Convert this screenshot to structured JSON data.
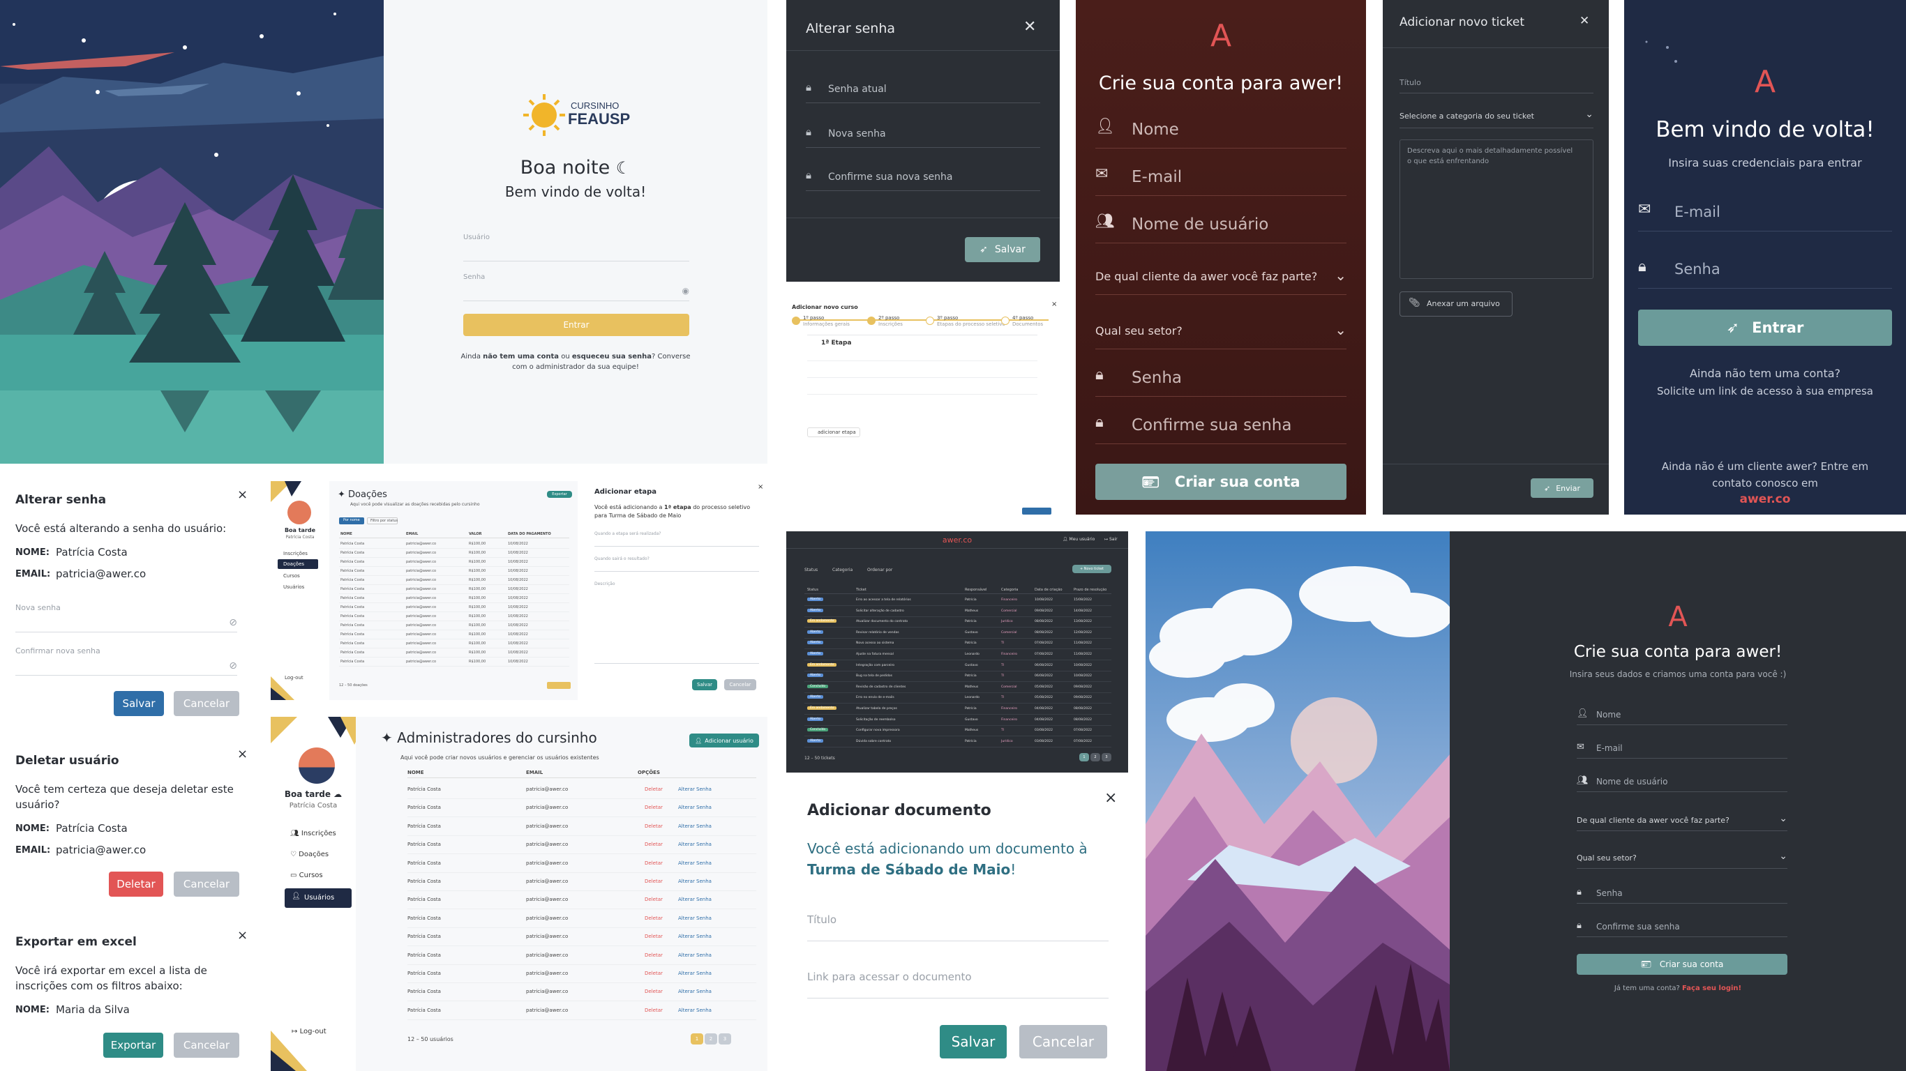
{
  "login_light": {
    "logo_top": "CURSINHO",
    "logo_main": "FEAUSP",
    "greeting": "Boa noite",
    "welcome": "Bem vindo de volta!",
    "user_placeholder": "Usuário",
    "password_placeholder": "Senha",
    "enter_button": "Entrar",
    "footer_1": "Ainda ",
    "footer_bold1": "não tem uma conta",
    "footer_2": " ou ",
    "footer_bold2": "esqueceu sua senha",
    "footer_3": "? Converse",
    "footer_4": "com o administrador da sua equipe!"
  },
  "change_pw_dark": {
    "title": "Alterar senha",
    "current": "Senha atual",
    "new": "Nova senha",
    "confirm": "Confirme sua nova senha",
    "save": "Salvar"
  },
  "wizard": {
    "title": "Adicionar novo curso",
    "steps": [
      {
        "label": "1º passo",
        "sub": "Informações gerais"
      },
      {
        "label": "2º passo",
        "sub": "Inscrições"
      },
      {
        "label": "3º passo",
        "sub": "Etapas do processo seletivo"
      },
      {
        "label": "4º passo",
        "sub": "Documentos"
      }
    ],
    "stage": "1ª Etapa",
    "add_stage": "adicionar etapa"
  },
  "signup_brown": {
    "title": "Crie sua conta para awer!",
    "name": "Nome",
    "email": "E-mail",
    "username": "Nome de usuário",
    "client": "De qual cliente da awer você faz parte?",
    "sector": "Qual seu setor?",
    "password": "Senha",
    "confirm": "Confirme sua senha",
    "button": "Criar sua conta"
  },
  "ticket": {
    "title": "Adicionar novo ticket",
    "field_title": "Título",
    "category": "Selecione a categoria do seu ticket",
    "description": "Descreva aqui o mais detalhadamente possível o que está enfrentando",
    "attach": "Anexar um arquivo",
    "send": "Enviar"
  },
  "login_navy": {
    "title": "Bem vindo de volta!",
    "subtitle": "Insira suas credenciais para entrar",
    "email": "E-mail",
    "password": "Senha",
    "button": "Entrar",
    "no_account_1": "Ainda não tem uma conta?",
    "no_account_2": "Solicite um link de acesso à sua empresa",
    "client_1": "Ainda não é um cliente awer? Entre em",
    "client_2": "contato conosco em",
    "link": "awer.co"
  },
  "dialogs": {
    "alter": {
      "title": "Alterar senha",
      "desc": "Você está alterando a senha do usuário:",
      "name_label": "NOME:",
      "name": "Patrícia Costa",
      "email_label": "EMAIL:",
      "email": "patricia@awer.co",
      "new_pw": "Nova senha",
      "confirm_pw": "Confirmar nova senha",
      "save": "Salvar",
      "cancel": "Cancelar"
    },
    "delete": {
      "title": "Deletar usuário",
      "desc_1": "Você tem certeza que deseja deletar este",
      "desc_2": "usuário?",
      "name_label": "NOME:",
      "name": "Patrícia Costa",
      "email_label": "EMAIL:",
      "email": "patricia@awer.co",
      "delete": "Deletar",
      "cancel": "Cancelar"
    },
    "export": {
      "title": "Exportar em excel",
      "desc_1": "Você irá exportar em excel a lista de",
      "desc_2": "inscrições com os filtros abaixo:",
      "name_label": "NOME:",
      "name": "Maria da Silva",
      "export": "Exportar",
      "cancel": "Cancelar"
    }
  },
  "donations": {
    "greeting": "Boa tarde",
    "user": "Patrícia Costa",
    "title": "Doações",
    "subtitle": "Aqui você pode visualizar as doações recebidas pelo cursinho",
    "export": "Exportar",
    "filters": [
      "Por nome",
      "Filtro por status"
    ],
    "columns": [
      "NOME",
      "EMAIL",
      "VALOR",
      "DATA DO PAGAMENTO"
    ],
    "row": [
      "Patrícia Costa",
      "patricia@awer.co",
      "R$100,00",
      "10/08/2022"
    ],
    "menu": [
      "Inscrições",
      "Doações",
      "Cursos",
      "Usuários"
    ],
    "logout": "Log-out",
    "count": "12 – 50 doações"
  },
  "add_stage": {
    "title": "Adicionar etapa",
    "desc_1": "Você está adicionando a ",
    "desc_bold": "1ª etapa",
    "desc_2": " do processo seletivo",
    "desc_3": "para Turma de Sábado de Maio",
    "field_1": "Quando a etapa será realizada?",
    "field_2": "Quando sairá o resultado?",
    "field_3": "Descrição",
    "save": "Salvar",
    "cancel": "Cancelar"
  },
  "admins": {
    "greeting": "Boa tarde",
    "user": "Patrícia Costa",
    "title": "Administradores do cursinho",
    "subtitle": "Aqui você pode criar novos usuários e gerenciar os usuários existentes",
    "add_button": "Adicionar usuário",
    "columns": [
      "NOME",
      "EMAIL",
      "OPÇÕES"
    ],
    "row_name": "Patrícia Costa",
    "row_email": "patricia@awer.co",
    "row_delete": "Deletar",
    "row_alter": "Alterar Senha",
    "menu": [
      "Inscrições",
      "Doações",
      "Cursos",
      "Usuários"
    ],
    "logout": "Log-out",
    "count": "12 – 50 usuários",
    "pages": [
      "1",
      "2",
      "3"
    ]
  },
  "tickets_table": {
    "logo": "awer.co",
    "user": "Meu usuário",
    "exit": "Sair",
    "filters": [
      "Status",
      "Categoria",
      "Ordenar por"
    ],
    "new_ticket": "+ Novo ticket",
    "columns": [
      "Status",
      "Ticket",
      "Responsável",
      "Categoria",
      "Data de criação",
      "Prazo de resolução"
    ],
    "rows": [
      {
        "status": "Aberto",
        "ticket": "Erro ao acessar a tela de relatórios",
        "resp": "Patrícia",
        "cat": "Financeiro",
        "created": "10/08/2022",
        "due": "15/08/2022"
      },
      {
        "status": "Aberto",
        "ticket": "Solicitar alteração de cadastro",
        "resp": "Matheus",
        "cat": "Comercial",
        "created": "09/08/2022",
        "due": "14/08/2022"
      },
      {
        "status": "Em andamento",
        "ticket": "Atualizar documento do contrato",
        "resp": "Patrícia",
        "cat": "Jurídico",
        "created": "08/08/2022",
        "due": "13/08/2022"
      },
      {
        "status": "Aberto",
        "ticket": "Revisar relatório de vendas",
        "resp": "Gustavo",
        "cat": "Comercial",
        "created": "08/08/2022",
        "due": "12/08/2022"
      },
      {
        "status": "Aberto",
        "ticket": "Novo acesso ao sistema",
        "resp": "Patrícia",
        "cat": "TI",
        "created": "07/08/2022",
        "due": "11/08/2022"
      },
      {
        "status": "Aberto",
        "ticket": "Ajuste na fatura mensal",
        "resp": "Leonardo",
        "cat": "Financeiro",
        "created": "07/08/2022",
        "due": "11/08/2022"
      },
      {
        "status": "Em andamento",
        "ticket": "Integração com parceiro",
        "resp": "Gustavo",
        "cat": "TI",
        "created": "06/08/2022",
        "due": "10/08/2022"
      },
      {
        "status": "Aberto",
        "ticket": "Bug na tela de pedidos",
        "resp": "Patrícia",
        "cat": "TI",
        "created": "06/08/2022",
        "due": "10/08/2022"
      },
      {
        "status": "Concluído",
        "ticket": "Revisão de cadastro de clientes",
        "resp": "Matheus",
        "cat": "Comercial",
        "created": "05/08/2022",
        "due": "09/08/2022"
      },
      {
        "status": "Aberto",
        "ticket": "Erro no envio de e-mails",
        "resp": "Leonardo",
        "cat": "TI",
        "created": "05/08/2022",
        "due": "09/08/2022"
      },
      {
        "status": "Em andamento",
        "ticket": "Atualizar tabela de preços",
        "resp": "Patrícia",
        "cat": "Financeiro",
        "created": "04/08/2022",
        "due": "08/08/2022"
      },
      {
        "status": "Aberto",
        "ticket": "Solicitação de reembolso",
        "resp": "Gustavo",
        "cat": "Financeiro",
        "created": "04/08/2022",
        "due": "08/08/2022"
      },
      {
        "status": "Concluído",
        "ticket": "Configurar nova impressora",
        "resp": "Matheus",
        "cat": "TI",
        "created": "03/08/2022",
        "due": "07/08/2022"
      },
      {
        "status": "Aberto",
        "ticket": "Dúvida sobre contrato",
        "resp": "Patrícia",
        "cat": "Jurídico",
        "created": "03/08/2022",
        "due": "07/08/2022"
      }
    ],
    "count": "12 – 50 tickets",
    "pages": [
      "1",
      "2",
      "3"
    ]
  },
  "add_doc": {
    "title": "Adicionar documento",
    "desc_1": "Você está adicionando um documento à",
    "desc_bold": "Turma de Sábado de Maio",
    "desc_2": "!",
    "field_title": "Título",
    "field_link": "Link para acessar o documento",
    "save": "Salvar",
    "cancel": "Cancelar"
  },
  "signup_dark": {
    "title": "Crie sua conta para awer!",
    "subtitle": "Insira seus dados e criamos uma conta para você :)",
    "name": "Nome",
    "email": "E-mail",
    "username": "Nome de usuário",
    "client": "De qual cliente da awer você faz parte?",
    "sector": "Qual seu setor?",
    "password": "Senha",
    "confirm": "Confirme sua senha",
    "button": "Criar sua conta",
    "footer": "Já tem uma conta? ",
    "footer_link": "Faça seu login!"
  },
  "colors": {
    "teal": "#2f8c86",
    "yellow": "#e8c15f",
    "red": "#e25555",
    "blue": "#2f6ea8",
    "sage": "#6b9b9a",
    "brown": "#4a1d1a",
    "navy": "#1f2a44",
    "dark": "#2b2f35"
  }
}
